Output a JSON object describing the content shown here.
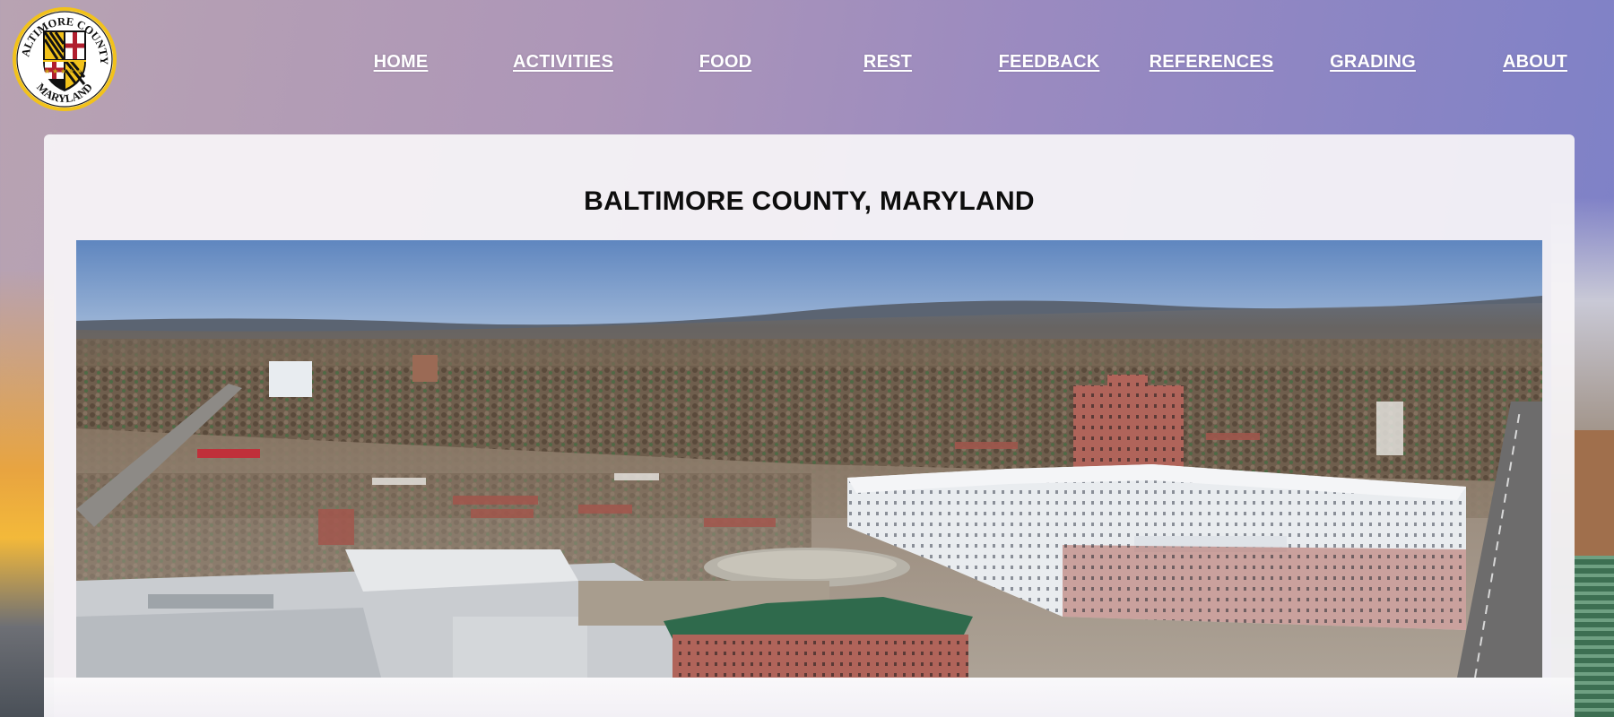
{
  "logo": {
    "top_text": "BALTIMORE COUNTY",
    "bottom_text": "MARYLAND"
  },
  "nav": {
    "items": [
      {
        "label": "HOME"
      },
      {
        "label": "ACTIVITIES"
      },
      {
        "label": "FOOD"
      },
      {
        "label": "REST"
      },
      {
        "label": "FEEDBACK"
      },
      {
        "label": "REFERENCES"
      },
      {
        "label": "GRADING"
      },
      {
        "label": "ABOUT"
      }
    ]
  },
  "main": {
    "title": "BALTIMORE COUNTY, MARYLAND"
  },
  "colors": {
    "nav_text": "#ffffff",
    "title_text": "#0d0d0d",
    "card_background": "#f7f5f8",
    "logo_gold": "#f2c21b"
  }
}
